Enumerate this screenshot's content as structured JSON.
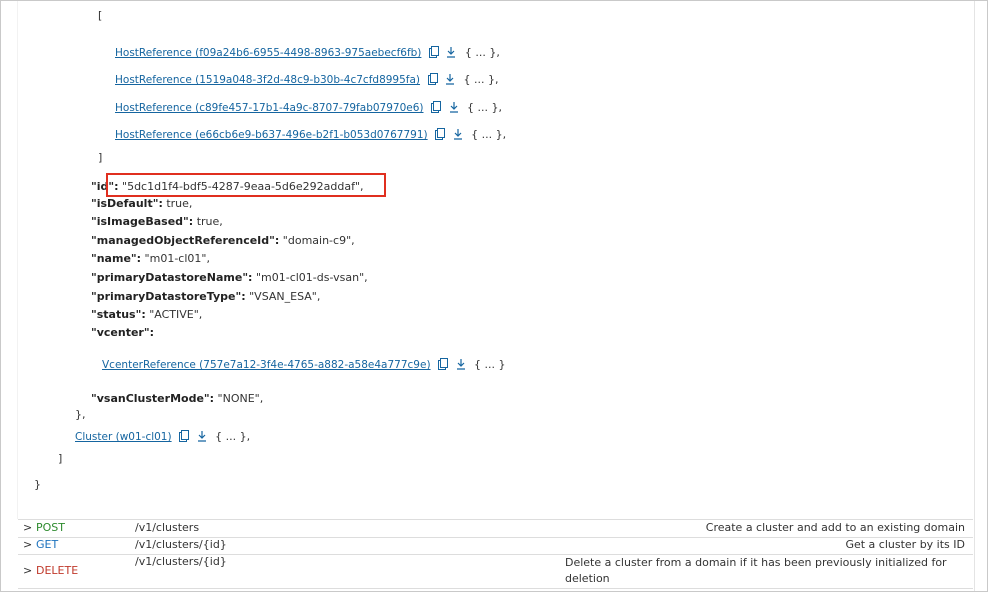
{
  "json_view": {
    "open_bracket": "[",
    "host_refs": [
      {
        "link": "HostReference (f09a24b6-6955-4498-8963-975aebecf6fb)",
        "collapsed": "{ ... },"
      },
      {
        "link": "HostReference (1519a048-3f2d-48c9-b30b-4c7cfd8995fa)",
        "collapsed": "{ ... },"
      },
      {
        "link": "HostReference (c89fe457-17b1-4a9c-8707-79fab07970e6)",
        "collapsed": "{ ... },"
      },
      {
        "link": "HostReference (e66cb6e9-b637-496e-b2f1-b053d0767791)",
        "collapsed": "{ ... },"
      }
    ],
    "close_bracket": "]",
    "fields": [
      {
        "key": "\"id\":",
        "value": "\"5dc1d1f4-bdf5-4287-9eaa-5d6e292addaf\","
      },
      {
        "key": "\"isDefault\":",
        "value": "true,"
      },
      {
        "key": "\"isImageBased\":",
        "value": "true,"
      },
      {
        "key": "\"managedObjectReferenceId\":",
        "value": "\"domain-c9\","
      },
      {
        "key": "\"name\":",
        "value": "\"m01-cl01\","
      },
      {
        "key": "\"primaryDatastoreName\":",
        "value": "\"m01-cl01-ds-vsan\","
      },
      {
        "key": "\"primaryDatastoreType\":",
        "value": "\"VSAN_ESA\","
      },
      {
        "key": "\"status\":",
        "value": "\"ACTIVE\","
      },
      {
        "key": "\"vcenter\":",
        "value": ""
      }
    ],
    "vcenter_ref": {
      "link": "VcenterReference (757e7a12-3f4e-4765-a882-a58e4a777c9e)",
      "collapsed": "{ ... }"
    },
    "vsan_field": {
      "key": "\"vsanClusterMode\":",
      "value": "\"NONE\","
    },
    "obj_close": "},",
    "cluster_ref": {
      "link": "Cluster (w01-cl01)",
      "collapsed": "{ ... },"
    },
    "array_close": "]",
    "root_close": "}"
  },
  "operations": [
    {
      "method": "POST",
      "path": "/v1/clusters",
      "desc": "Create a cluster and add to an existing domain"
    },
    {
      "method": "GET",
      "path": "/v1/clusters/{id}",
      "desc": "Get a cluster by its ID"
    },
    {
      "method": "DELETE",
      "path": "/v1/clusters/{id}",
      "desc": "Delete a cluster from a domain if it has been previously initialized for deletion"
    }
  ],
  "colors": {
    "highlight": "#e02f1f",
    "link": "#1565a0",
    "post": "#2e8b2e",
    "get": "#1e73be",
    "delete": "#c0392b"
  },
  "icons": [
    "copy-icon",
    "download-icon",
    "chevron-right-icon"
  ]
}
